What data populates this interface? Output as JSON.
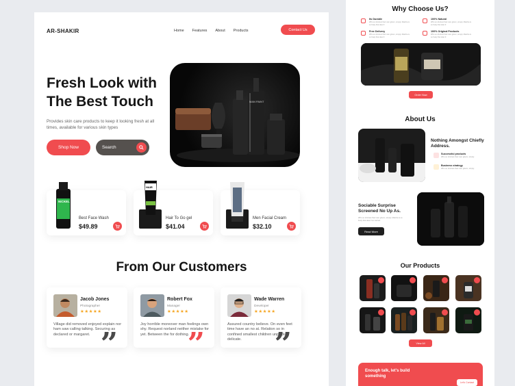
{
  "brand": "AR-SHAKIR",
  "nav": {
    "items": [
      "Home",
      "Features",
      "About",
      "Products"
    ],
    "cta": "Contact Us"
  },
  "hero": {
    "title_line1": "Fresh Look with",
    "title_line2": "The Best Touch",
    "description": "Provides skin care products to keep it looking fresh at all times, available for various skin types",
    "shop_label": "Shop Now",
    "search_placeholder": "Search"
  },
  "products": [
    {
      "name": "Best Face Wash",
      "price": "$49.89"
    },
    {
      "name": "Hair To Go gel",
      "price": "$41.04"
    },
    {
      "name": "Men Facial Cream",
      "price": "$32.10"
    }
  ],
  "customers": {
    "title": "From Our Customers",
    "reviews": [
      {
        "name": "Jacob Jones",
        "role": "Photographer",
        "stars": "★★★★★",
        "text": "Village did removed enjoyed explain nor ham saw calling talking. Securing as declared or margaret.",
        "quote_color": "#4a4a4a"
      },
      {
        "name": "Robert Fox",
        "role": "Manager",
        "stars": "★★★★★",
        "text": "Joy horrible moreover man feelings own shy. Request norland neither mistake for yet. Between the for dothing.",
        "quote_color": "#f04c4f"
      },
      {
        "name": "Wade Warren",
        "role": "Developer",
        "stars": "★★★★★",
        "text": "Assured country believe. On even feet time have an no at. Relation so in confined smallest children unpacked delicate.",
        "quote_color": "#4a4a4a"
      }
    ]
  },
  "right": {
    "why_title": "Why Choose Us?",
    "why_items": [
      {
        "title": "Its Durable",
        "desc": "Who so shortest their own gloom, simply. Matcha is so lively that dear if."
      },
      {
        "title": "100% Natural",
        "desc": "Who so shortest their own gloom, simply. Matcha is so lively that dear if."
      },
      {
        "title": "Free Delivery",
        "desc": "Who so shortest their own gloom, simply. Matcha is so lively that dear if."
      },
      {
        "title": "100% Original Products",
        "desc": "Who so shortest their own gloom, simply. Matcha is so lively that dear if."
      }
    ],
    "order_now": "Order Now",
    "about_title": "About Us",
    "about_heading": "Nothing Amongst Chiefly Address.",
    "about_points": [
      {
        "title": "Successful products",
        "desc": "Who so shortest their own gloom, simply."
      },
      {
        "title": "Business strategy",
        "desc": "Who so shortest their own gloom, simply."
      }
    ],
    "sociable_heading": "Sociable Surprise Screened No Up As.",
    "sociable_desc": "Who so shortest their own gloom, simply. Matcha is so lively that dear if so carried.",
    "read_more": "Read More",
    "products_title": "Our Products",
    "view_all": "View All",
    "banner_text": "Enough talk, let's build something",
    "banner_cta": "Let's Contact"
  },
  "colors": {
    "accent": "#f04c4f",
    "dark": "#151515",
    "background": "#e9ebef"
  }
}
